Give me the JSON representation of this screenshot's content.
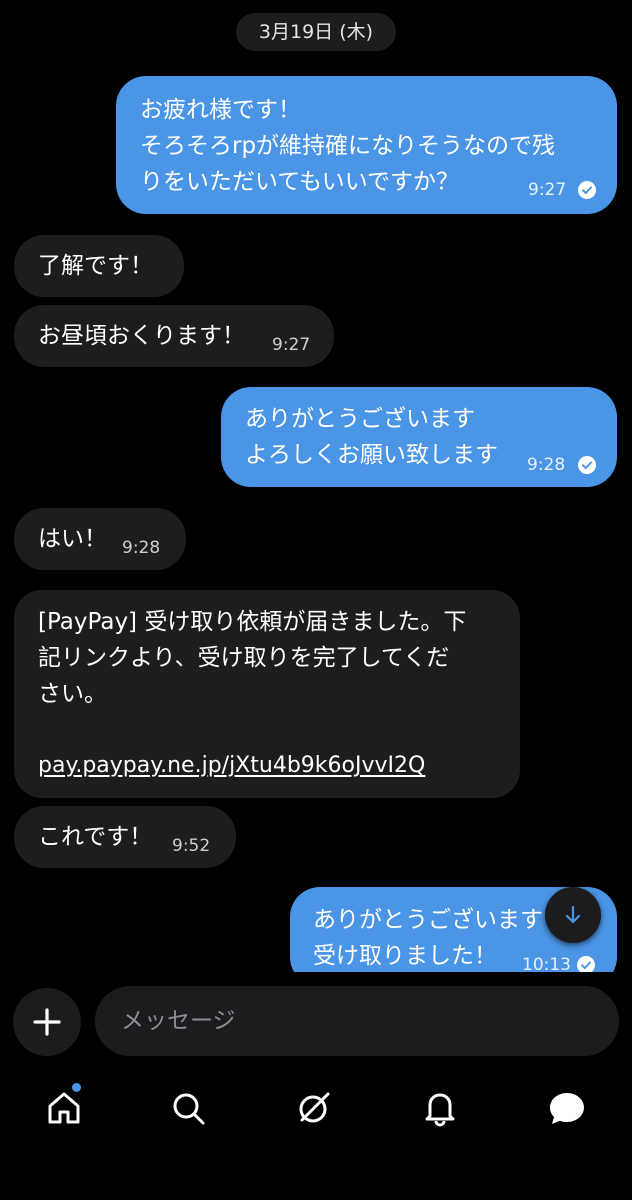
{
  "date_label": "3月19日 (木)",
  "messages": [
    {
      "direction": "outgoing",
      "lines": [
        "お疲れ様です！",
        "そろそろrpが維持確になりそうなので残",
        "りをいただいてもいいですか？"
      ],
      "time": "9:27",
      "status": "read"
    },
    {
      "direction": "incoming",
      "lines": [
        "了解です！"
      ]
    },
    {
      "direction": "incoming",
      "lines": [
        "お昼頃おくります！"
      ],
      "time": "9:27"
    },
    {
      "direction": "outgoing",
      "lines": [
        "ありがとうございます",
        "よろしくお願い致します"
      ],
      "time": "9:28",
      "status": "read"
    },
    {
      "direction": "incoming",
      "lines": [
        "はい！"
      ],
      "time": "9:28"
    },
    {
      "direction": "incoming",
      "lines": [
        "[PayPay] 受け取り依頼が届きました。下",
        "記リンクより、受け取りを完了してくだ",
        "さい。",
        "",
        "pay.paypay.ne.jp/jXtu4b9k6oJvvI2Q"
      ]
    },
    {
      "direction": "incoming",
      "lines": [
        "これです！"
      ],
      "time": "9:52"
    },
    {
      "direction": "outgoing",
      "lines": [
        "ありがとうございます",
        "受け取りました！"
      ],
      "time": "10:13",
      "status": "read"
    }
  ],
  "composer": {
    "placeholder": "メッセージ"
  },
  "icons": {
    "plus": "plus-icon",
    "scroll_down": "arrow-down-icon",
    "check": "check-circle-icon",
    "nav": [
      "home-icon",
      "search-icon",
      "grok-icon",
      "bell-icon",
      "chat-bubble-icon"
    ]
  },
  "colors": {
    "background": "#000000",
    "outgoing_bubble": "#4a95e6",
    "incoming_bubble": "#1d1d20",
    "accent": "#4a95e6"
  }
}
